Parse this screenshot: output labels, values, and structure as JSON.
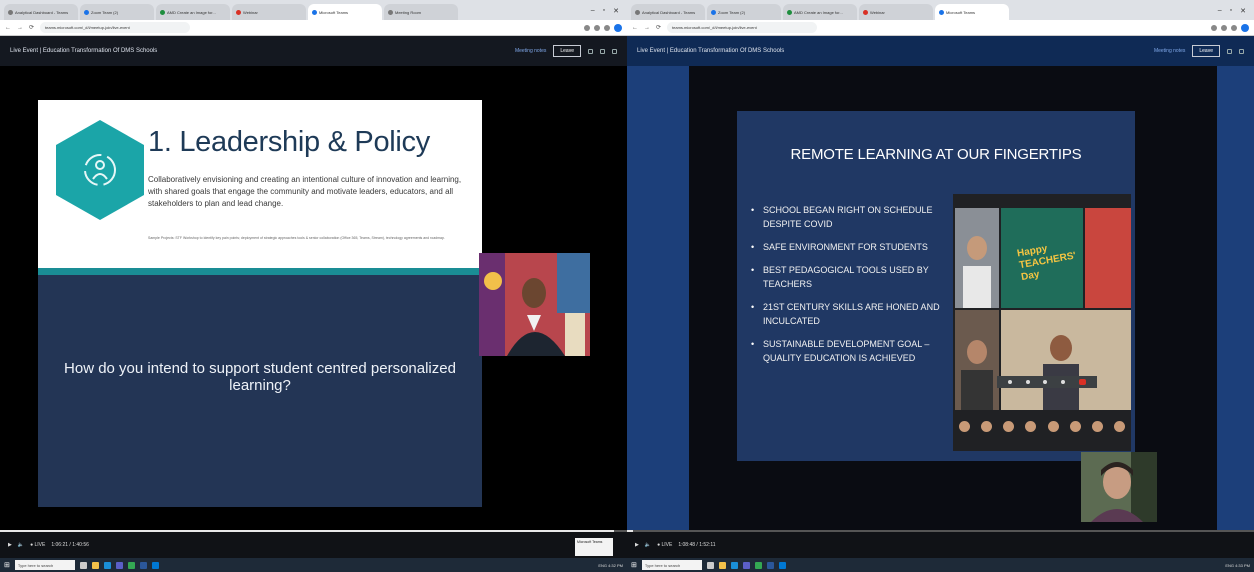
{
  "tabs": [
    {
      "label": "Analytical Dashboard - Teams"
    },
    {
      "label": "Zoom Team (2)"
    },
    {
      "label": "AMD Create an Image for..."
    },
    {
      "label": "Webinar"
    },
    {
      "label": "Microsoft Teams"
    },
    {
      "label": "Meeting Room"
    }
  ],
  "address": "teams.microsoft.com/_#/l/meetup-join/live-event",
  "event_title": "Live Event | Education Transformation Of DMS Schools",
  "event_controls": {
    "link": "Meeting notes",
    "button": "Leave"
  },
  "left_slide": {
    "title": "1. Leadership & Policy",
    "body": "Collaboratively envisioning and creating an intentional culture of innovation and learning, with shared goals that engage the community and motivate leaders, educators, and all stakeholders to plan and lead change.",
    "small": "Sample Projects: STF Workshop to identify key pain points; deployment of strategic approaches tools & senior collaboration (Office 365, Teams, Stream), technology agreements and roadmap.",
    "question": "How do you intend to support student centred personalized learning?"
  },
  "right_slide": {
    "title": "REMOTE LEARNING AT OUR FINGERTIPS",
    "bullets": [
      "SCHOOL BEGAN RIGHT ON SCHEDULE DESPITE COVID",
      "SAFE ENVIRONMENT FOR STUDENTS",
      "BEST PEDAGOGICAL TOOLS USED BY TEACHERS",
      "21st CENTURY SKILLS ARE HONED AND INCULCATED",
      "SUSTAINABLE DEVELOPMENT GOAL –QUALITY EDUCATION IS ACHIEVED"
    ],
    "meet_banner": "Happy TEACHERS' Day"
  },
  "video_controls": {
    "left_time": "1:06:21 / 1:40:56",
    "right_time": "1:08:48 / 1:52:11",
    "left_progress": 0.98,
    "right_progress": 0.01
  },
  "taskbar": {
    "search_placeholder": "Type here to search",
    "tray_left": "ENG 4:32 PM",
    "tray_right": "ENG 4:33 PM",
    "tooltip": "Microsoft Teams"
  },
  "colors": {
    "slide_navy": "#233555",
    "teal": "#1ba5a8",
    "right_slide": "#203864"
  }
}
